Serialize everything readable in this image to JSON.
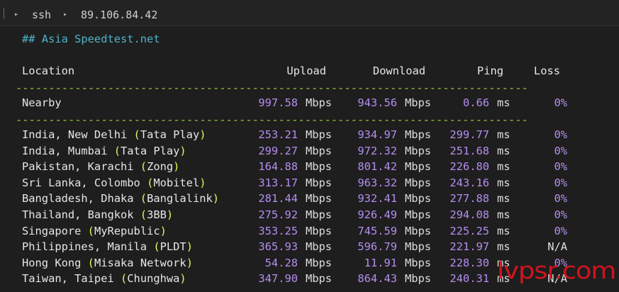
{
  "tabbar": {
    "crumb1": "ssh",
    "crumb2": "89.106.84.42"
  },
  "heading": "## Asia Speedtest.net",
  "columns": {
    "location": "Location",
    "upload": "Upload",
    "download": "Download",
    "ping": "Ping",
    "loss": "Loss"
  },
  "separator": "------------------------------------------------------------------------------",
  "nearby": {
    "location": "Nearby",
    "upload": "997.58",
    "download": "943.56",
    "ping": "0.66",
    "loss": "0%"
  },
  "units": {
    "speed": "Mbps",
    "ping": "ms"
  },
  "rows": [
    {
      "place": "India, New Delhi ",
      "isp": "Tata Play",
      "upload": "253.21",
      "download": "934.97",
      "ping": "299.77",
      "loss": "0%"
    },
    {
      "place": "India, Mumbai ",
      "isp": "Tata Play",
      "upload": "299.27",
      "download": "972.32",
      "ping": "251.68",
      "loss": "0%"
    },
    {
      "place": "Pakistan, Karachi ",
      "isp": "Zong",
      "upload": "164.88",
      "download": "801.42",
      "ping": "226.80",
      "loss": "0%"
    },
    {
      "place": "Sri Lanka, Colombo ",
      "isp": "Mobitel",
      "upload": "313.17",
      "download": "963.32",
      "ping": "243.16",
      "loss": "0%"
    },
    {
      "place": "Bangladesh, Dhaka ",
      "isp": "Banglalink",
      "upload": "281.44",
      "download": "932.41",
      "ping": "277.88",
      "loss": "0%"
    },
    {
      "place": "Thailand, Bangkok ",
      "isp": "3BB",
      "upload": "275.92",
      "download": "926.49",
      "ping": "294.08",
      "loss": "0%"
    },
    {
      "place": "Singapore ",
      "isp": "MyRepublic",
      "upload": "353.25",
      "download": "745.59",
      "ping": "225.25",
      "loss": "0%"
    },
    {
      "place": "Philippines, Manila ",
      "isp": "PLDT",
      "upload": "365.93",
      "download": "596.79",
      "ping": "221.97",
      "loss": "N/A"
    },
    {
      "place": "Hong Kong ",
      "isp": "Misaka Network",
      "upload": "54.28",
      "download": "11.91",
      "ping": "228.30",
      "loss": "0%"
    },
    {
      "place": "Taiwan, Taipei ",
      "isp": "Chunghwa",
      "upload": "347.90",
      "download": "864.43",
      "ping": "240.31",
      "loss": "N/A"
    }
  ],
  "watermark": "lvpsr.com"
}
